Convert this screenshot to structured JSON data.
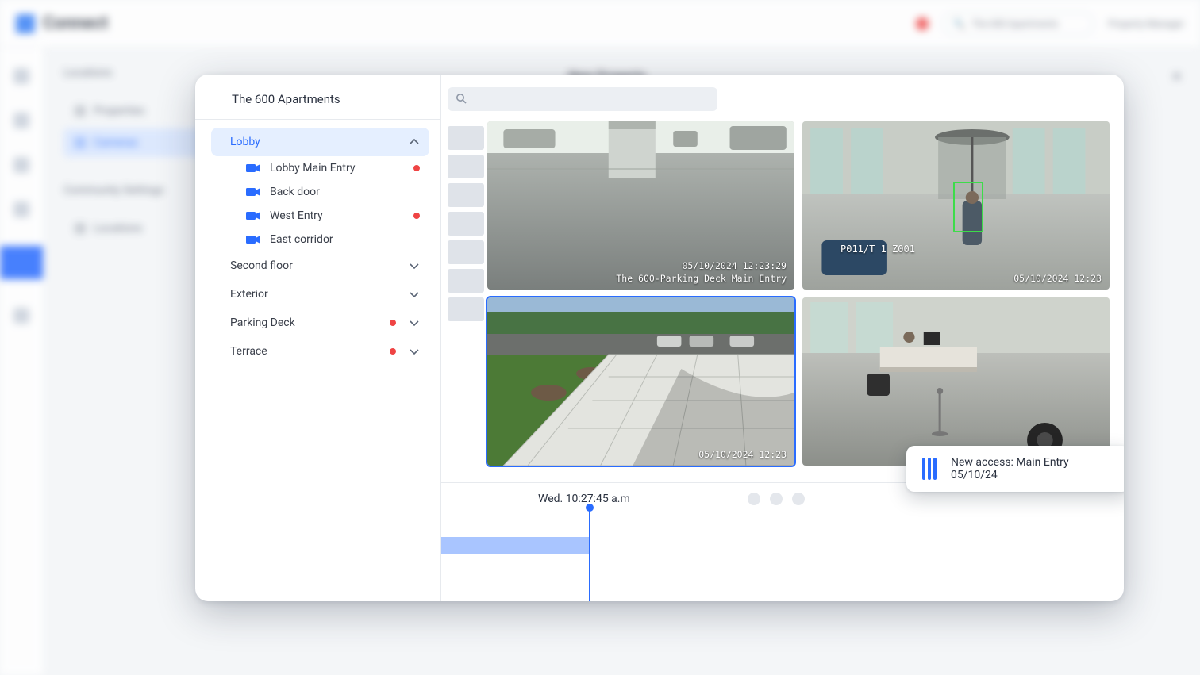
{
  "app": {
    "brand": "Connect",
    "search_placeholder": "The 600 Apartments",
    "role_label": "Property Manager"
  },
  "bg_sidebar": {
    "section1_title": "Locations",
    "items1": [
      "Properties",
      "Cameras"
    ],
    "section2_title": "Community Settings",
    "items2": [
      "Locations"
    ],
    "page_title": "New Property"
  },
  "panel": {
    "property_name": "The 600 Apartments",
    "search_placeholder": "",
    "groups": [
      {
        "name": "Lobby",
        "expanded": true,
        "alert": false,
        "cameras": [
          {
            "name": "Lobby Main Entry",
            "alert": true
          },
          {
            "name": "Back door",
            "alert": false
          },
          {
            "name": "West Entry",
            "alert": true
          },
          {
            "name": "East corridor",
            "alert": false
          }
        ]
      },
      {
        "name": "Second floor",
        "expanded": false,
        "alert": false
      },
      {
        "name": "Exterior",
        "expanded": false,
        "alert": false
      },
      {
        "name": "Parking Deck",
        "expanded": false,
        "alert": true
      },
      {
        "name": "Terrace",
        "expanded": false,
        "alert": true
      }
    ]
  },
  "feeds": {
    "tiles": [
      {
        "id": "parking-deck",
        "timestamp": "05/10/2024 12:23:29",
        "caption": "The 600-Parking Deck Main Entry"
      },
      {
        "id": "lobby-revolving",
        "overlay_mid": "P011/T 1  Z001",
        "timestamp_small": "05/10/2024 12:23",
        "detection": true
      },
      {
        "id": "main-entry-walk",
        "selected": true,
        "timestamp_small": "05/10/2024 12:23"
      },
      {
        "id": "lobby-desk"
      }
    ]
  },
  "timeline": {
    "label": "Wed. 10:27:45 a.m"
  },
  "toast": {
    "text": "New access: Main Entry 05/10/24"
  }
}
